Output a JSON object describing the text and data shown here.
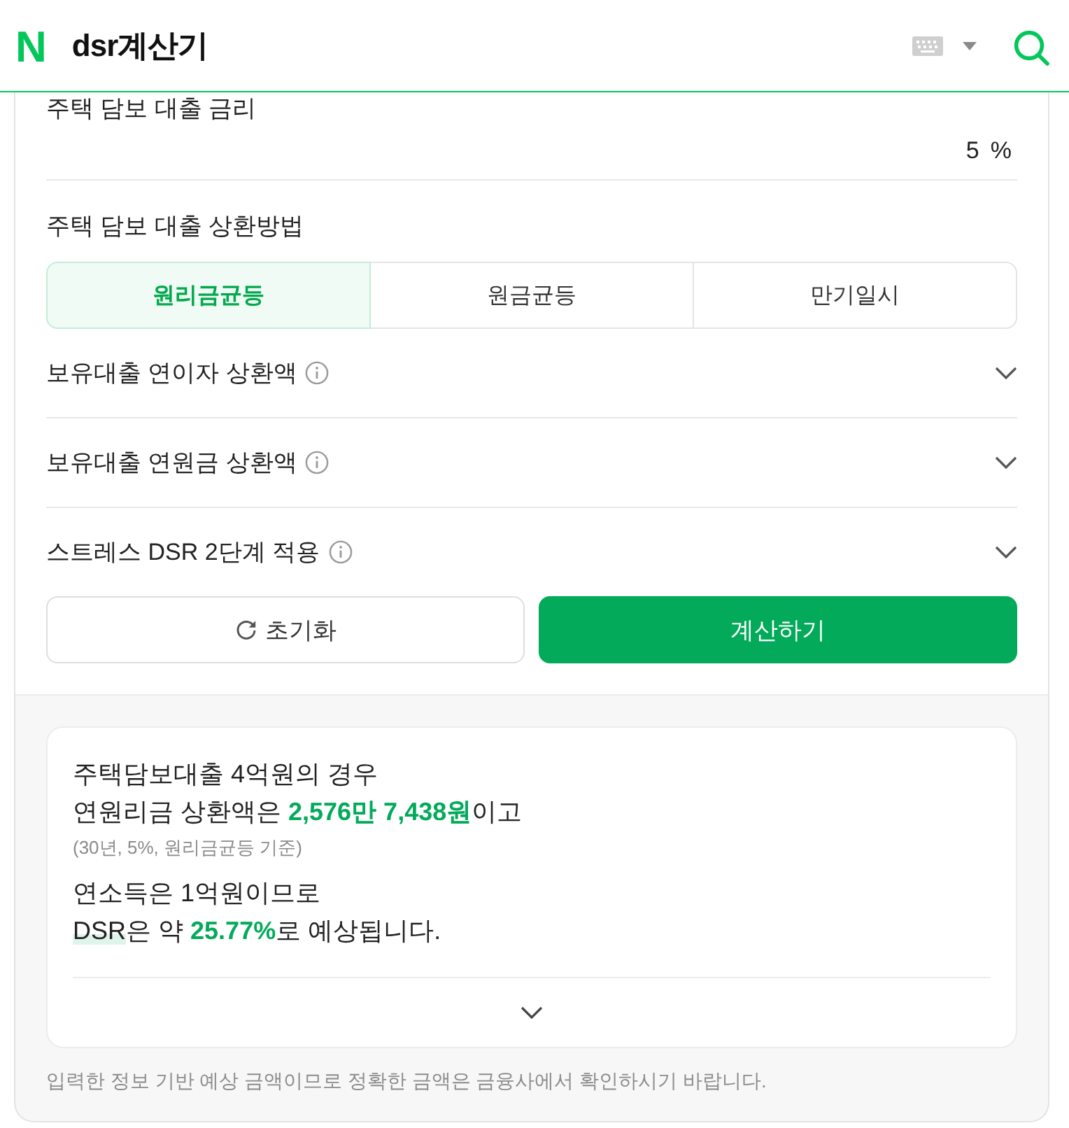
{
  "header": {
    "logo": "N",
    "title": "dsr계산기"
  },
  "form": {
    "rate": {
      "label": "주택 담보 대출 금리",
      "value": "5",
      "unit": "%"
    },
    "repayment": {
      "label": "주택 담보 대출 상환방법",
      "options": [
        {
          "label": "원리금균등",
          "selected": true
        },
        {
          "label": "원금균등",
          "selected": false
        },
        {
          "label": "만기일시",
          "selected": false
        }
      ]
    },
    "sections": [
      {
        "label": "보유대출 연이자 상환액",
        "expanded": false
      },
      {
        "label": "보유대출 연원금 상환액",
        "expanded": false
      },
      {
        "label": "스트레스 DSR 2단계 적용",
        "expanded": false
      }
    ],
    "buttons": [
      {
        "kind": "reset",
        "label": "초기화"
      },
      {
        "kind": "calculate",
        "label": "계산하기"
      }
    ]
  },
  "result": {
    "expanded": false,
    "paragraphs": [
      {
        "kind": "statement",
        "lines": [
          [
            {
              "kind": "plain",
              "text": "주택담보대출 4억원의 경우"
            }
          ],
          [
            {
              "kind": "plain",
              "text": "연원리금 상환액은 "
            },
            {
              "kind": "figure",
              "text": "2,576만 7,438원"
            },
            {
              "kind": "plain",
              "text": "이고"
            }
          ]
        ]
      },
      {
        "kind": "note",
        "lines": [
          [
            {
              "kind": "plain",
              "text": "(30년, 5%, 원리금균등 기준)"
            }
          ]
        ]
      },
      {
        "kind": "statement",
        "lines": [
          [
            {
              "kind": "plain",
              "text": "연소득은 1억원이므로"
            }
          ],
          [
            {
              "kind": "term",
              "text": "DSR"
            },
            {
              "kind": "plain",
              "text": "은 약 "
            },
            {
              "kind": "figure",
              "text": "25.77%"
            },
            {
              "kind": "plain",
              "text": "로 예상됩니다."
            }
          ]
        ]
      }
    ]
  },
  "disclaimer": "입력한 정보 기반 예상 금액이므로 정확한 금액은 금융사에서 확인하시기 바랍니다."
}
